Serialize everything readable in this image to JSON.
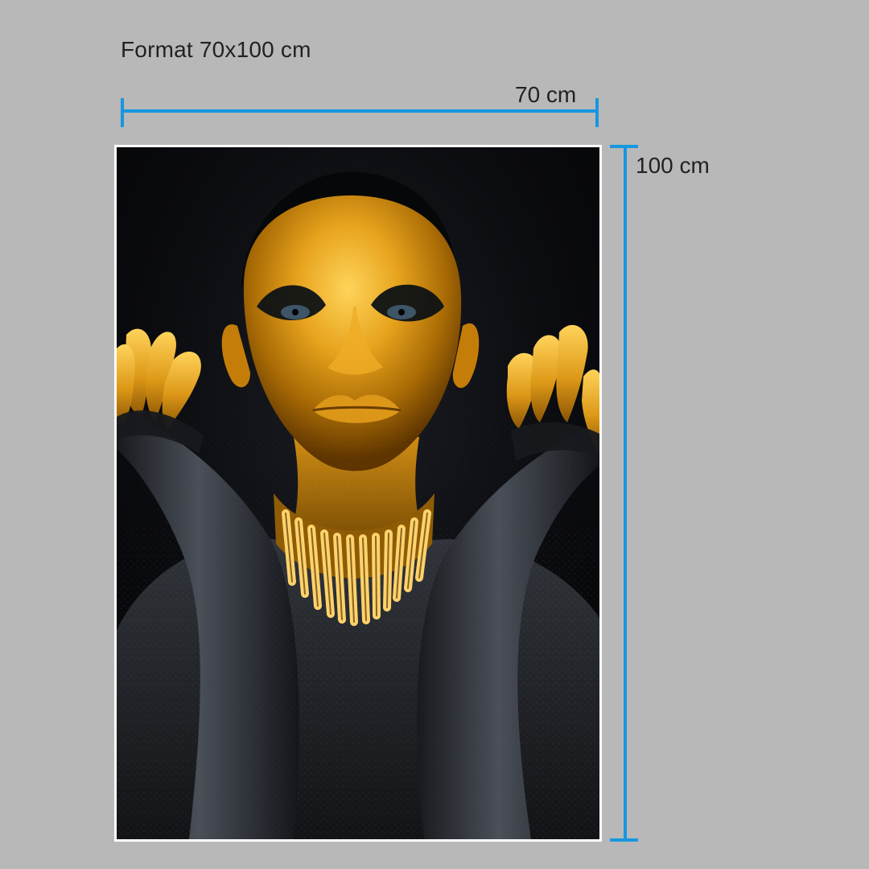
{
  "header": {
    "format_label": "Format 70x100 cm"
  },
  "dimensions": {
    "width_label": "70 cm",
    "height_label": "100 cm",
    "accent_color": "#1697e0"
  },
  "poster": {
    "background_color": "#050608",
    "paint_gold": "#d89a12",
    "paint_black": "#23262b"
  }
}
